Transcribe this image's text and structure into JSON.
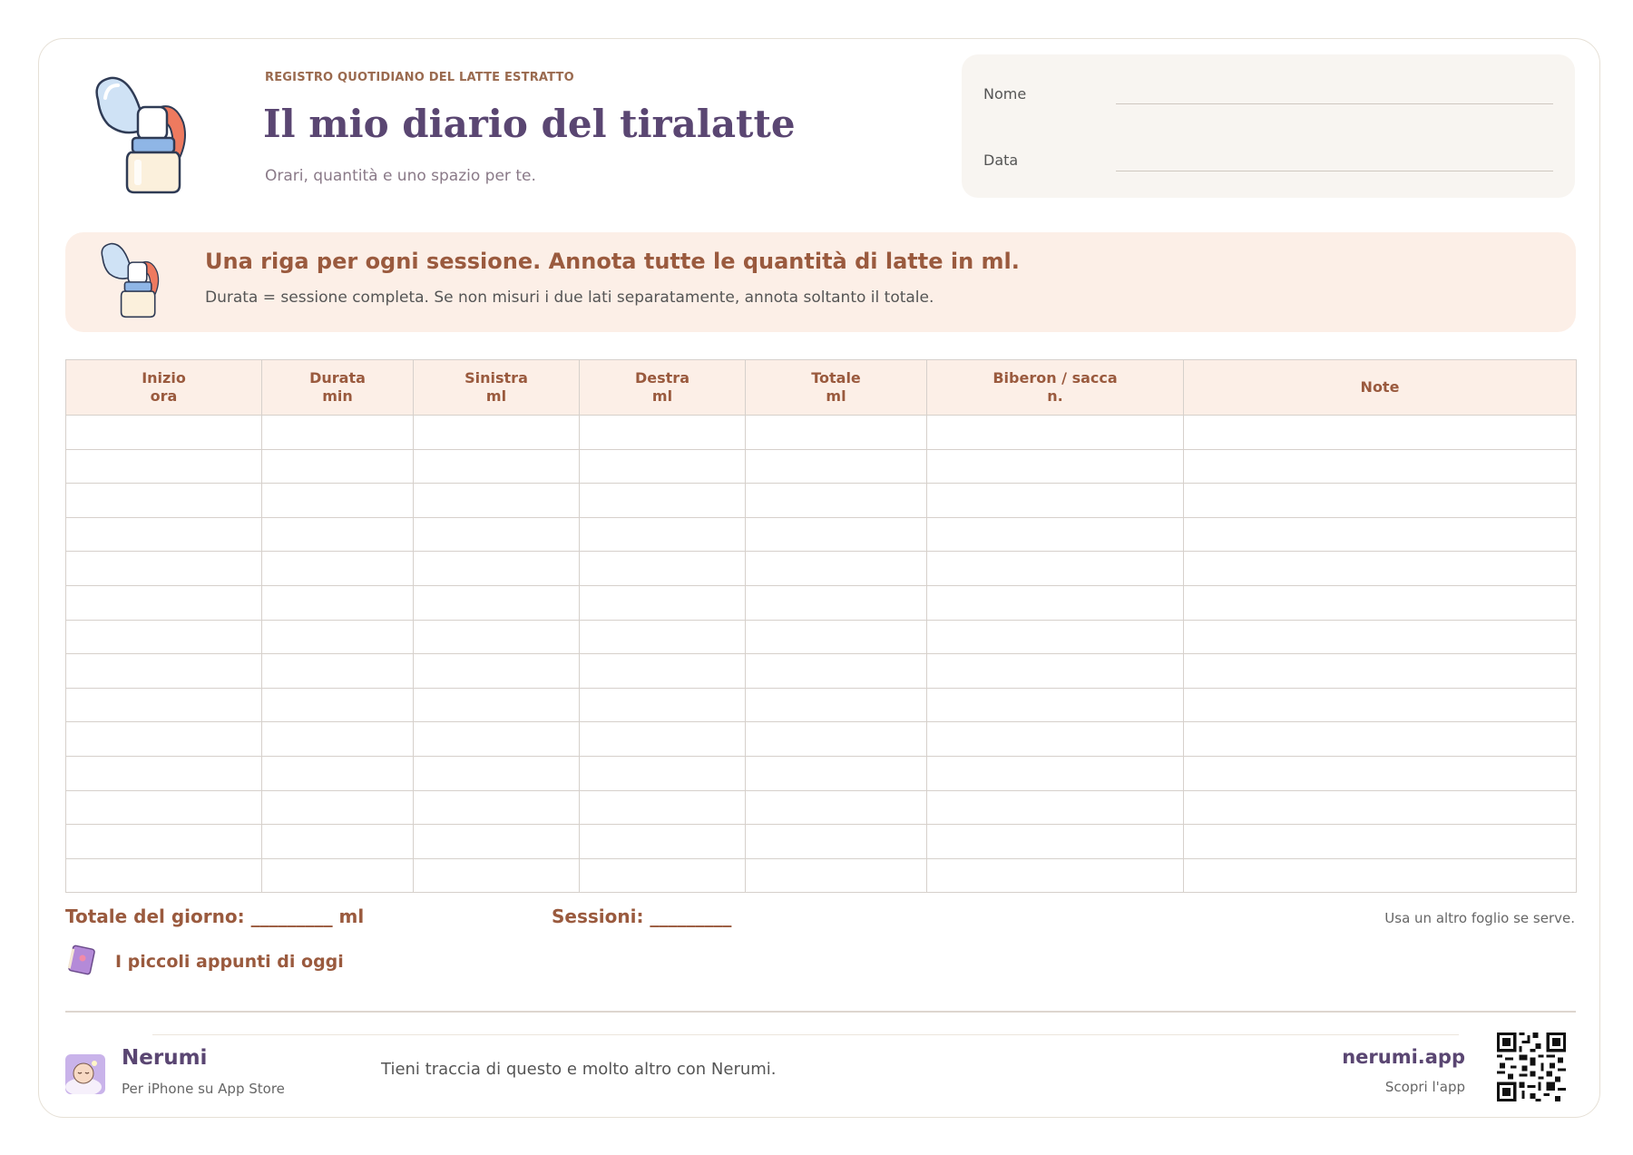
{
  "header": {
    "eyebrow": "REGISTRO QUOTIDIANO DEL LATTE ESTRATTO",
    "title": "Il mio diario del tiralatte",
    "subtitle": "Orari, quantità e uno spazio per te."
  },
  "fields": {
    "name_label": "Nome",
    "date_label": "Data"
  },
  "banner": {
    "title": "Una riga per ogni sessione. Annota tutte le quantità di latte in ml.",
    "text": "Durata = sessione completa. Se non misuri i due lati separatamente, annota soltanto il totale."
  },
  "table": {
    "columns": [
      {
        "l1": "Inizio",
        "l2": "ora"
      },
      {
        "l1": "Durata",
        "l2": "min"
      },
      {
        "l1": "Sinistra",
        "l2": "ml"
      },
      {
        "l1": "Destra",
        "l2": "ml"
      },
      {
        "l1": "Totale",
        "l2": "ml"
      },
      {
        "l1": "Biberon / sacca",
        "l2": "n."
      },
      {
        "l1": "Note",
        "l2": ""
      }
    ],
    "row_count": 14
  },
  "totals": {
    "day": "Totale del giorno: _________ ml",
    "sessions": "Sessioni: _________",
    "note": "Usa un altro foglio se serve."
  },
  "notes": {
    "title": "I piccoli appunti di oggi"
  },
  "footer": {
    "brand": "Nerumi",
    "brand_sub": "Per iPhone su App Store",
    "tagline": "Tieni traccia di questo e molto altro con Nerumi.",
    "url": "nerumi.app",
    "cta": "Scopri l'app"
  },
  "icons": {
    "pump": "breast-pump-icon",
    "notes": "notebook-icon",
    "avatar": "sleeping-baby-icon",
    "qr": "qr-code"
  },
  "colors": {
    "accent_brown": "#9a5a3e",
    "brand_purple": "#5a4672",
    "banner_bg": "#fcefe7",
    "field_bg": "#f8f5f1"
  }
}
